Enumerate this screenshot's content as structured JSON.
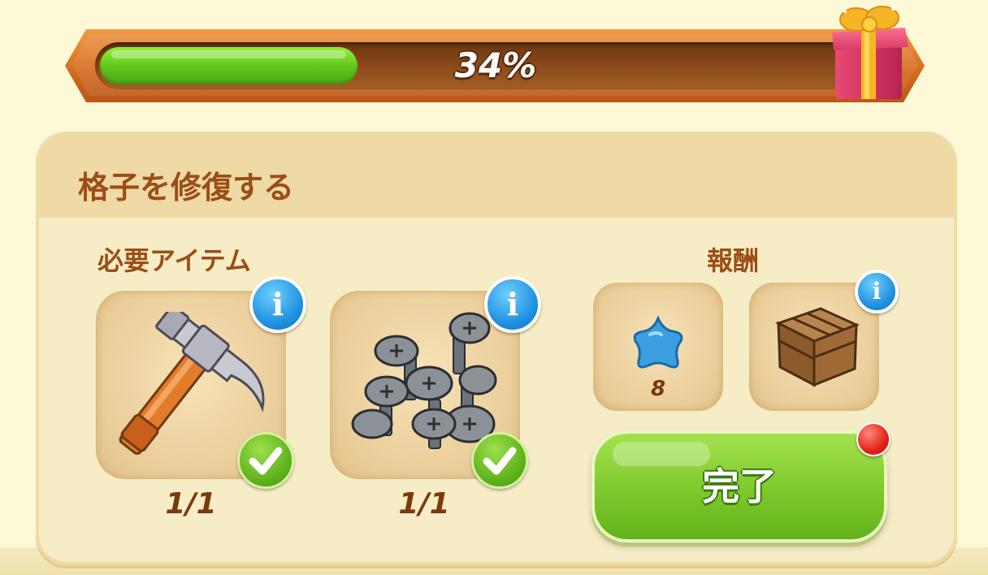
{
  "progress": {
    "percent_text": "34%",
    "fraction": 0.34
  },
  "task": {
    "title": "格子を修復する"
  },
  "required": {
    "label": "必要アイテム",
    "items": [
      {
        "icon": "hammer-icon",
        "count": "1/1",
        "status": "complete"
      },
      {
        "icon": "screws-icon",
        "count": "1/1",
        "status": "complete"
      }
    ]
  },
  "rewards": {
    "label": "報酬",
    "items": [
      {
        "icon": "blue-star-icon",
        "count": "8"
      },
      {
        "icon": "wooden-crate-icon",
        "count": ""
      }
    ]
  },
  "complete_button": {
    "label": "完了"
  },
  "info_symbol": "i",
  "colors": {
    "accent_green": "#7ec82c",
    "header_text": "#9a4e16",
    "progress_frame": "#d26a1f"
  }
}
